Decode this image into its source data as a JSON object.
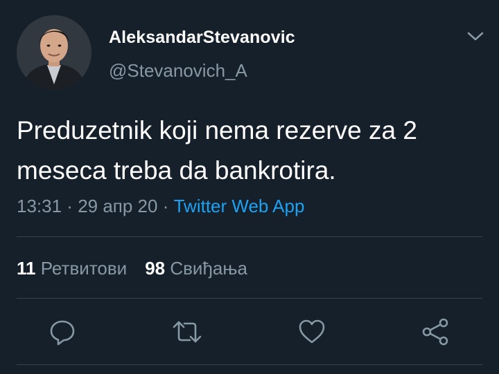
{
  "user": {
    "display_name": "AleksandarStevanovic",
    "handle": "@Stevanovich_A"
  },
  "tweet": {
    "text": "Preduzetnik koji nema rezerve za 2 meseca treba da bankrotira.",
    "time": "13:31",
    "separator1": " · ",
    "date": "29 апр 20",
    "separator2": " · ",
    "source": "Twitter Web App"
  },
  "stats": {
    "retweets_count": "11",
    "retweets_label": "Ретвитови",
    "likes_count": "98",
    "likes_label": "Свиђања"
  },
  "actions": {
    "icons": [
      "reply-icon",
      "retweet-icon",
      "like-icon",
      "share-icon"
    ]
  },
  "colors": {
    "background": "#15202b",
    "text_primary": "#ffffff",
    "text_secondary": "#8899a6",
    "accent": "#1da1f2",
    "divider": "#38444d"
  }
}
